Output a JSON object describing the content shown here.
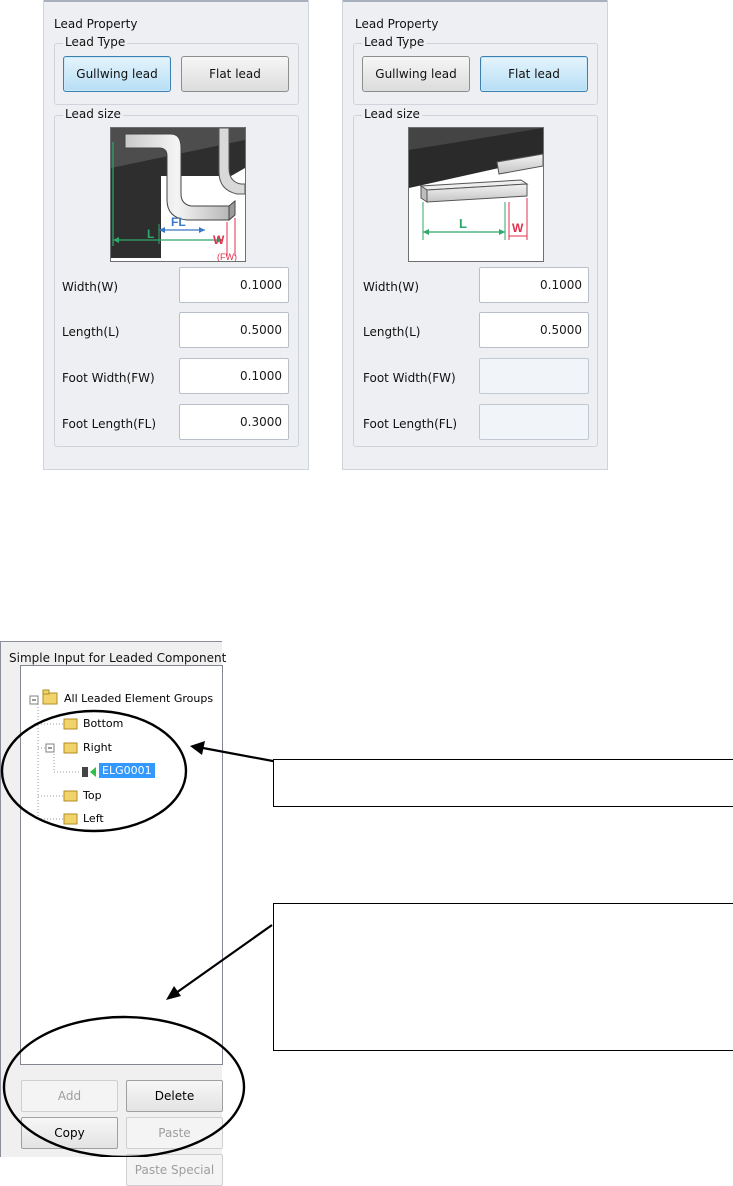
{
  "left_panel": {
    "title": "Lead Property",
    "lead_type_label": "Lead Type",
    "gullwing_label": "Gullwing lead",
    "flat_label": "Flat lead",
    "active": "gullwing",
    "lead_size_label": "Lead size",
    "diagram_labels": {
      "fl": "FL",
      "l": "L",
      "w": "W",
      "fw": "(FW)"
    },
    "fields": [
      {
        "label": "Width(W)",
        "value": "0.1000"
      },
      {
        "label": "Length(L)",
        "value": "0.5000"
      },
      {
        "label": "Foot Width(FW)",
        "value": "0.1000"
      },
      {
        "label": "Foot Length(FL)",
        "value": "0.3000"
      }
    ]
  },
  "right_panel": {
    "title": "Lead Property",
    "lead_type_label": "Lead Type",
    "gullwing_label": "Gullwing lead",
    "flat_label": "Flat lead",
    "active": "flat",
    "lead_size_label": "Lead size",
    "diagram_labels": {
      "l": "L",
      "w": "W"
    },
    "fields": [
      {
        "label": "Width(W)",
        "value": "0.1000"
      },
      {
        "label": "Length(L)",
        "value": "0.5000"
      },
      {
        "label": "Foot Width(FW)",
        "value": ""
      },
      {
        "label": "Foot Length(FL)",
        "value": ""
      }
    ]
  },
  "window": {
    "title": "Simple Input for Leaded Component",
    "tree": {
      "root": "All Leaded Element Groups",
      "groups": [
        "Bottom",
        "Right",
        "Top",
        "Left"
      ],
      "selected_item": "ELG0001"
    },
    "buttons": {
      "add": "Add",
      "delete": "Delete",
      "copy": "Copy",
      "paste": "Paste",
      "paste_special": "Paste Special"
    }
  },
  "colors": {
    "active_button": "#b6def5",
    "selection": "#3399ff",
    "dim_green": "#2fa86b",
    "dim_blue": "#3a78c8",
    "dim_red": "#e0304d"
  }
}
